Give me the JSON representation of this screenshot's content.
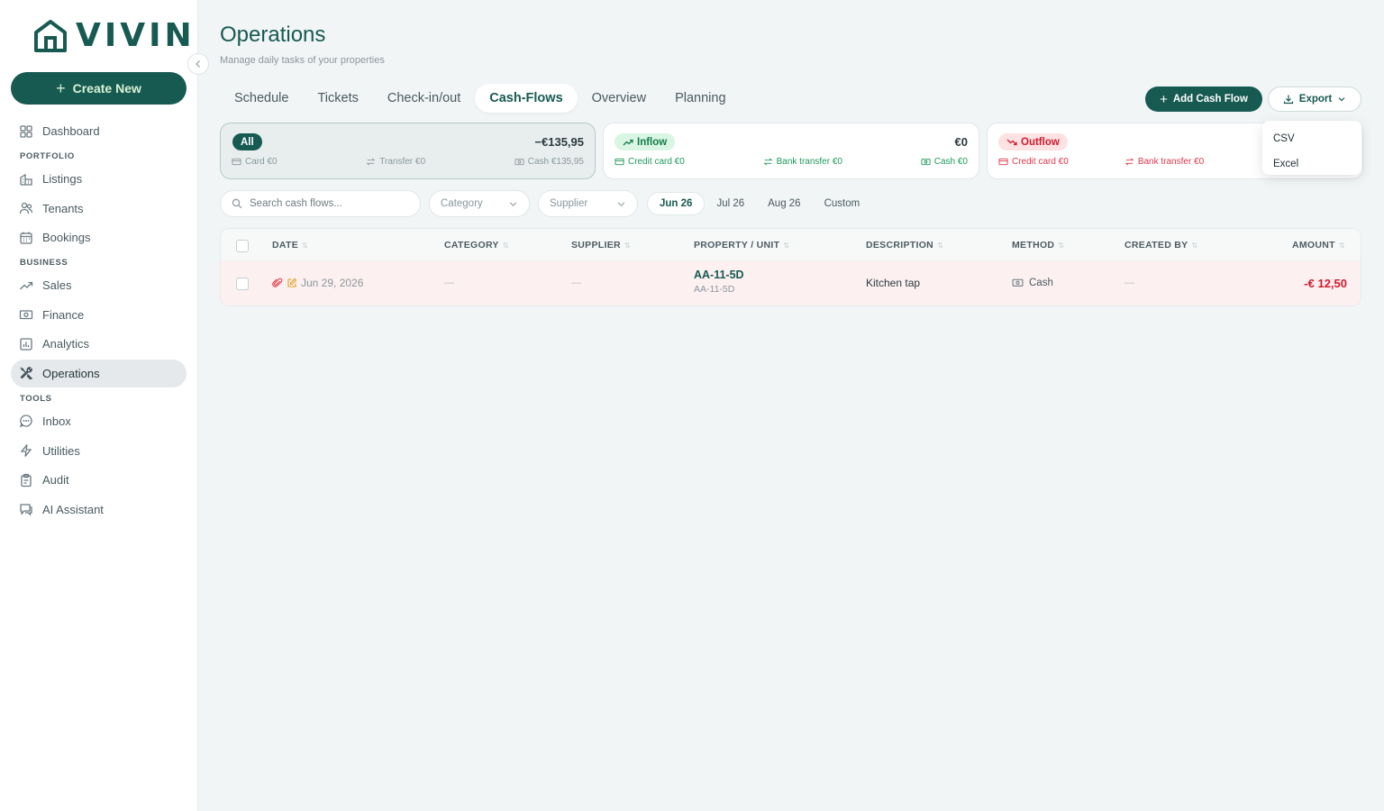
{
  "app": {
    "logo_text": "VIVIN"
  },
  "sidebar": {
    "create_label": "Create New",
    "items": [
      {
        "label": "Dashboard",
        "icon": "grid-icon"
      },
      {
        "section": "PORTFOLIO"
      },
      {
        "label": "Listings",
        "icon": "building-icon"
      },
      {
        "label": "Tenants",
        "icon": "users-icon"
      },
      {
        "label": "Bookings",
        "icon": "calendar-icon"
      },
      {
        "section": "BUSINESS"
      },
      {
        "label": "Sales",
        "icon": "trending-up-icon"
      },
      {
        "label": "Finance",
        "icon": "banknote-icon"
      },
      {
        "label": "Analytics",
        "icon": "bar-chart-icon"
      },
      {
        "label": "Operations",
        "icon": "tools-icon",
        "active": true
      },
      {
        "section": "TOOLS"
      },
      {
        "label": "Inbox",
        "icon": "chat-icon"
      },
      {
        "label": "Utilities",
        "icon": "bolt-icon"
      },
      {
        "label": "Audit",
        "icon": "clipboard-icon"
      },
      {
        "label": "AI Assistant",
        "icon": "ai-chat-icon"
      }
    ]
  },
  "header": {
    "title": "Operations",
    "subtitle": "Manage daily tasks of your properties"
  },
  "tabs": [
    {
      "label": "Schedule"
    },
    {
      "label": "Tickets"
    },
    {
      "label": "Check-in/out"
    },
    {
      "label": "Cash-Flows",
      "active": true
    },
    {
      "label": "Overview"
    },
    {
      "label": "Planning"
    }
  ],
  "actions": {
    "add_label": "Add Cash Flow",
    "export_label": "Export",
    "export_options": [
      "CSV",
      "Excel"
    ]
  },
  "summary": {
    "all": {
      "badge": "All",
      "total": "−€135,95",
      "card": "Card €0",
      "transfer": "Transfer €0",
      "cash": "Cash €135,95"
    },
    "inflow": {
      "badge": "Inflow",
      "total": "€0",
      "card": "Credit card €0",
      "transfer": "Bank transfer €0",
      "cash": "Cash €0"
    },
    "outflow": {
      "badge": "Outflow",
      "card": "Credit card €0",
      "transfer": "Bank transfer €0"
    }
  },
  "filters": {
    "search_placeholder": "Search cash flows...",
    "category": "Category",
    "supplier": "Supplier",
    "months": [
      {
        "label": "Jun 26",
        "active": true
      },
      {
        "label": "Jul 26"
      },
      {
        "label": "Aug 26"
      },
      {
        "label": "Custom"
      }
    ]
  },
  "table": {
    "columns": [
      "DATE",
      "CATEGORY",
      "SUPPLIER",
      "PROPERTY / UNIT",
      "DESCRIPTION",
      "METHOD",
      "CREATED BY",
      "AMOUNT"
    ],
    "rows": [
      {
        "date": "Jun 29, 2026",
        "category": "—",
        "supplier": "—",
        "property": "AA-11-5D",
        "unit": "AA-11-5D",
        "description": "Kitchen tap",
        "method": "Cash",
        "created_by": "—",
        "amount": "-€ 12,50"
      }
    ]
  },
  "colors": {
    "brand": "#175a52",
    "danger": "#d11a2d",
    "success": "#1f9a5c",
    "background": "#f1f5f6"
  }
}
